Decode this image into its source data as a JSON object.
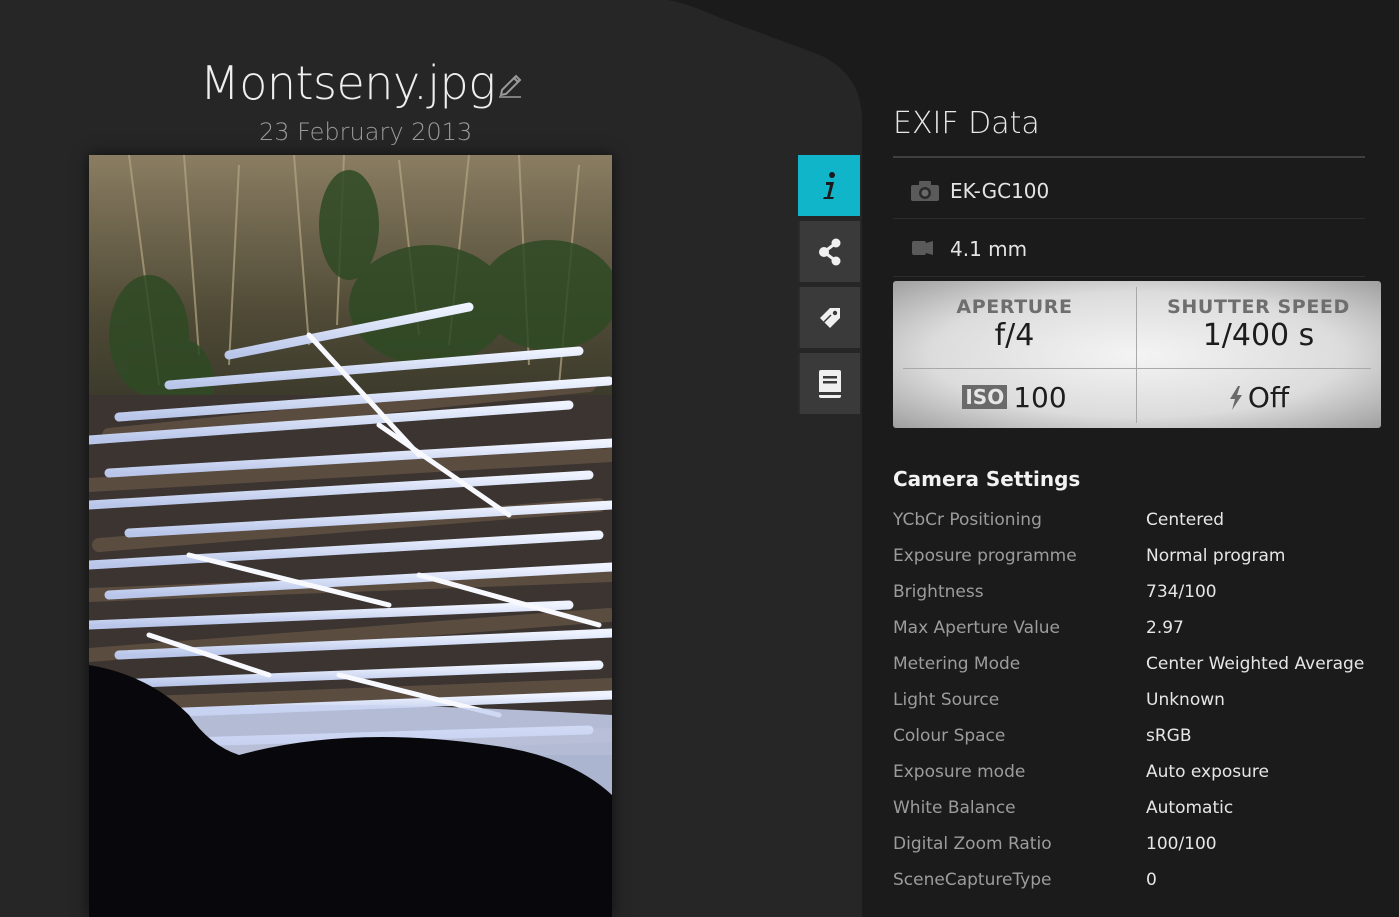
{
  "header": {
    "filename": "Montseny.jpg",
    "date": "23 February 2013"
  },
  "side_tabs": [
    {
      "name": "info",
      "icon": "info-icon",
      "active": true
    },
    {
      "name": "share",
      "icon": "share-icon",
      "active": false
    },
    {
      "name": "tags",
      "icon": "tag-icon",
      "active": false
    },
    {
      "name": "notes",
      "icon": "notebook-icon",
      "active": false
    }
  ],
  "exif": {
    "title": "EXIF Data",
    "camera_model": "EK-GC100",
    "focal_length": "4.1 mm",
    "aperture_label": "APERTURE",
    "aperture_value": "f/4",
    "shutter_label": "SHUTTER SPEED",
    "shutter_value": "1/400 s",
    "iso_badge": "ISO",
    "iso_value": "100",
    "flash_value": "Off"
  },
  "camera_settings": {
    "title": "Camera Settings",
    "rows": [
      {
        "key": "YCbCr Positioning",
        "value": "Centered"
      },
      {
        "key": "Exposure programme",
        "value": "Normal program"
      },
      {
        "key": "Brightness",
        "value": "734/100"
      },
      {
        "key": "Max Aperture Value",
        "value": "2.97"
      },
      {
        "key": "Metering Mode",
        "value": "Center Weighted Average"
      },
      {
        "key": "Light Source",
        "value": "Unknown"
      },
      {
        "key": "Colour Space",
        "value": "sRGB"
      },
      {
        "key": "Exposure mode",
        "value": "Auto exposure"
      },
      {
        "key": "White Balance",
        "value": "Automatic"
      },
      {
        "key": "Digital Zoom Ratio",
        "value": "100/100"
      },
      {
        "key": "SceneCaptureType",
        "value": "0"
      }
    ]
  },
  "colors": {
    "accent": "#11b5c9",
    "background": "#1b1b1b",
    "panel": "#262626"
  }
}
